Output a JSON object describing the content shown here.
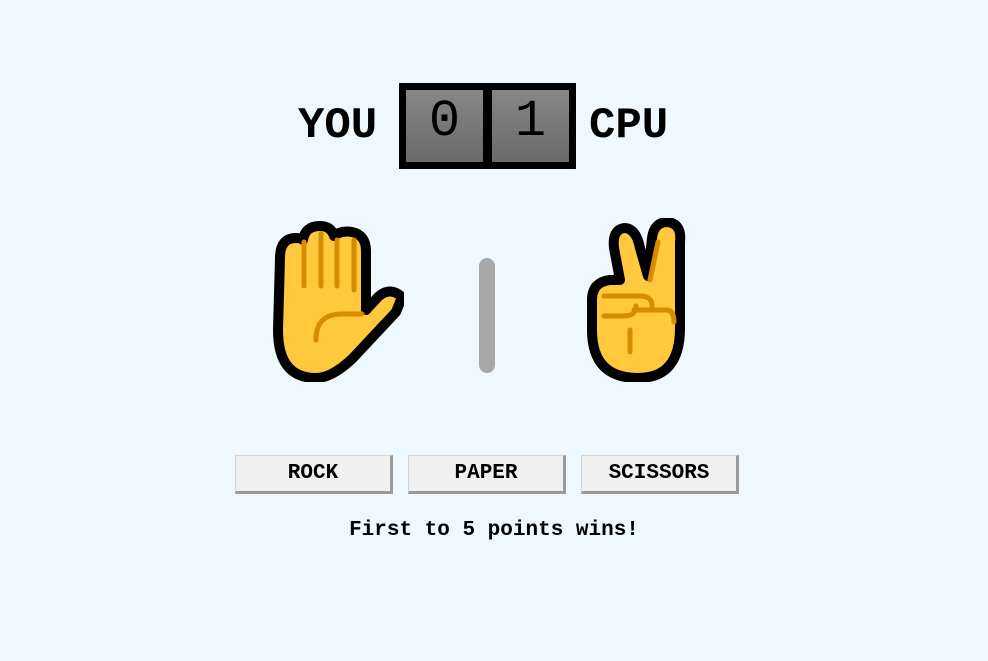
{
  "scoreboard": {
    "player_label": "YOU",
    "cpu_label": "CPU",
    "player_score": "0",
    "cpu_score": "1"
  },
  "hands": {
    "player_choice": "paper",
    "player_icon": "raised-hand-icon",
    "cpu_choice": "scissors",
    "cpu_icon": "victory-hand-icon",
    "skin_color": "#ffc83d",
    "crease_color": "#d68c00",
    "outline_color": "#000000"
  },
  "controls": {
    "rock_label": "ROCK",
    "paper_label": "PAPER",
    "scissors_label": "SCISSORS"
  },
  "status": {
    "message": "First to 5 points wins!"
  },
  "colors": {
    "background": "#eff7ff",
    "divider": "#a8a8a8",
    "score_tile": "#7a7a7a"
  }
}
